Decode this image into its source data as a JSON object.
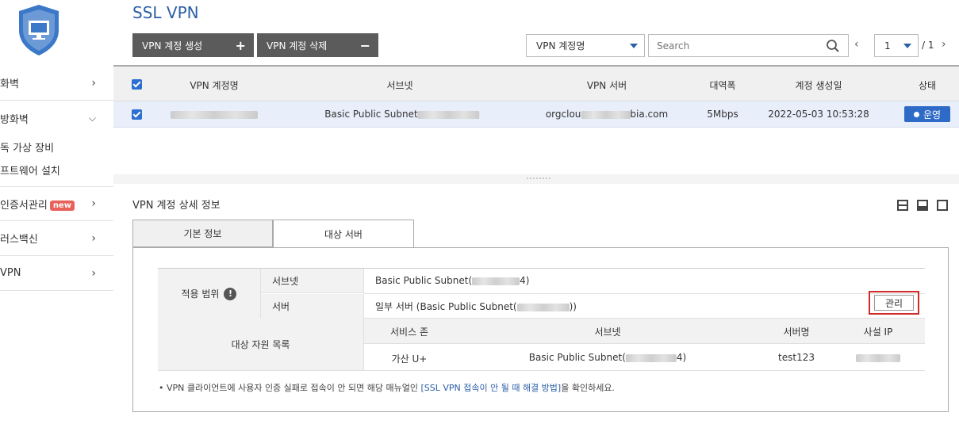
{
  "sidebar": {
    "items": [
      {
        "label": "화벽",
        "expanded": false
      },
      {
        "label": "방화벽",
        "expanded": true
      },
      {
        "label": " 인증서관리",
        "badge": "new",
        "expanded": false
      },
      {
        "label": "바이러스백신",
        "expanded": false
      },
      {
        "label": " VPN",
        "expanded": false
      }
    ],
    "subitems": [
      "독 가상 장비",
      "프트웨어 설치"
    ],
    "trunc_labels": [
      "화벽",
      "방화벽",
      "러스백신"
    ]
  },
  "page": {
    "title": "SSL VPN"
  },
  "toolbar": {
    "create_label": "VPN 계정 생성",
    "delete_label": "VPN 계정 삭제",
    "filter_selected": "VPN 계정명",
    "search_placeholder": "Search",
    "page_current": "1",
    "page_total": "/ 1"
  },
  "table": {
    "headers": [
      "VPN 계정명",
      "서브넷",
      "VPN 서버",
      "대역폭",
      "계정 생성일",
      "상태"
    ],
    "rows": [
      {
        "subnet": "Basic Public Subnet",
        "server_prefix": "orgclou",
        "server_suffix": "bia.com",
        "bandwidth": "5Mbps",
        "created": "2022-05-03 10:53:28",
        "status": "운영"
      }
    ]
  },
  "detail": {
    "title": "VPN 계정 상세 정보",
    "tabs": [
      "기본 정보",
      "대상 서버"
    ],
    "active_tab": 1,
    "scope_label": "적용 범위",
    "subnet_label": "서브넷",
    "subnet_value": "Basic Public Subnet(",
    "subnet_value_end": "4)",
    "server_label": "서버",
    "server_value": "일부 서버 (Basic Public Subnet(",
    "server_value_end": "))",
    "manage_label": "관리",
    "resource_label": "대상 자원 목록",
    "resource_headers": [
      "서비스 존",
      "서브넷",
      "서버명",
      "사설 IP"
    ],
    "resource_row": {
      "zone": "가산 U+",
      "subnet": "Basic Public Subnet(",
      "subnet_end": "4)",
      "server": "test123"
    },
    "note_pre": "• VPN 클라이언트에 사용자 인증 실패로 접속이 안 되면 해당 매뉴얼인 ",
    "note_link": "[SSL VPN 접속이 안 될 때 해결 방법]",
    "note_post": "을 확인하세요."
  },
  "colors": {
    "accent": "#2b5fa8",
    "dark_button": "#5b5b5b",
    "status": "#2e6bc6",
    "highlight": "#d12a2a"
  }
}
